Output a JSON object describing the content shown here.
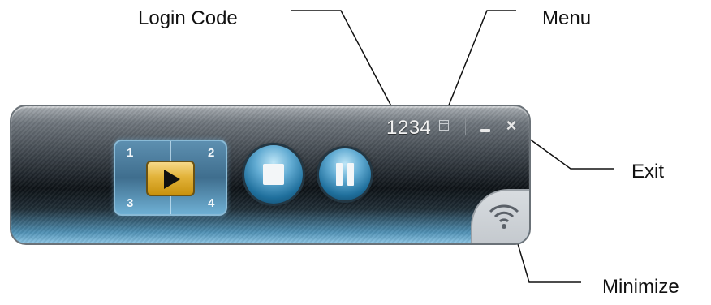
{
  "callouts": {
    "login_code": "Login Code",
    "menu": "Menu",
    "exit": "Exit",
    "minimize": "Minimize"
  },
  "toolbar": {
    "login_code": "1234",
    "menu_icon": "menu-list-icon",
    "minimize_icon": "minimize-icon",
    "close_icon": "close-icon",
    "close_glyph": "×"
  },
  "controls": {
    "quad_labels": [
      "1",
      "2",
      "3",
      "4"
    ],
    "play_icon": "play-icon",
    "stop_icon": "stop-icon",
    "pause_icon": "pause-icon",
    "status_icon": "wifi-icon"
  },
  "colors": {
    "accent_blue": "#63acd3",
    "play_gold": "#e2b33a",
    "panel_dark": "#1c2228"
  }
}
